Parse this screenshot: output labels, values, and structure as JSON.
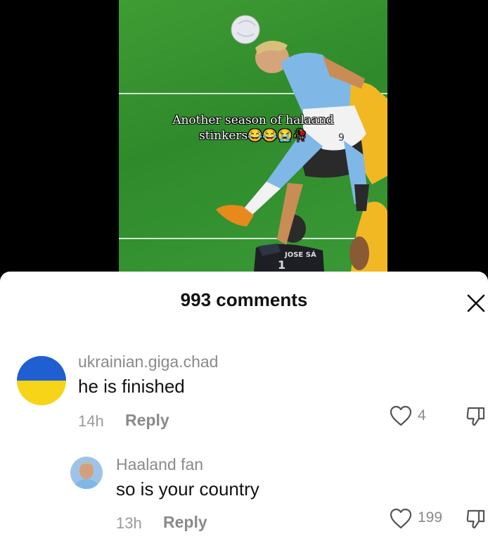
{
  "video": {
    "caption_line1": "Another season of halaand",
    "caption_line2": "stinkers😂😂😭🥀",
    "jersey_number": "9",
    "keeper_name": "JOSE SÁ",
    "keeper_number": "1"
  },
  "comments_sheet": {
    "title": "993 comments",
    "close_icon": "close-icon"
  },
  "comments": [
    {
      "username": "ukrainian.giga.chad",
      "text": "he is finished",
      "time": "14h",
      "reply_label": "Reply",
      "likes": "4",
      "avatar": "ukraine-flag-avatar"
    },
    {
      "username": "Haaland fan",
      "text": "so is your country",
      "time": "13h",
      "reply_label": "Reply",
      "likes": "199",
      "avatar": "player-photo-avatar"
    }
  ],
  "colors": {
    "flag_blue": "#1f5fd1",
    "flag_yellow": "#f7d417",
    "pitch_green": "#3a9a36",
    "sky_blue_kit": "#7fb8e6"
  }
}
